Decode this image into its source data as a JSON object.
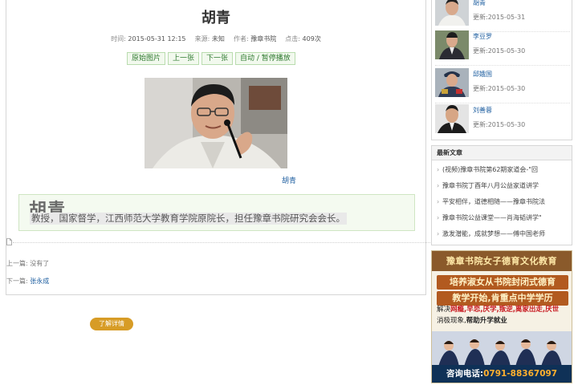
{
  "article": {
    "title": "胡青",
    "meta": {
      "time_label": "时间:",
      "time": "2015-05-31 12:15",
      "source_label": "来源:",
      "source": "未知",
      "author_label": "作者:",
      "author": "豫章书院",
      "views_label": "点击:",
      "views": "409次"
    },
    "buttons": [
      "原始图片",
      "上一张",
      "下一张",
      "自动 / 暂停播放"
    ],
    "photo_caption": "胡青",
    "bio": {
      "name": "胡青",
      "text": "教授，国家督学，江西师范大学教育学院原院长，担任豫章书院研究会会长。"
    },
    "nav": {
      "prev_label": "上一篇:",
      "prev_value": "没有了",
      "next_label": "下一篇:",
      "next_value": "张永成"
    }
  },
  "sidebar": {
    "authors": [
      {
        "name": "胡青",
        "date": "更新:2015-05-31"
      },
      {
        "name": "李豆罗",
        "date": "更新:2015-05-30"
      },
      {
        "name": "邱娥国",
        "date": "更新:2015-05-30"
      },
      {
        "name": "刘善蓉",
        "date": "更新:2015-05-30"
      }
    ],
    "latest": {
      "title": "最新文章",
      "items": [
        "(视频)豫章书院第62期家道会-\"回",
        "豫章书院丁酉年八月公益家道讲学",
        "平安相伴，道德相随——豫章书院法",
        "豫章书院公益课堂——肖海韬讲学\"",
        "激发潜能，成就梦想——傅中国老师"
      ]
    }
  },
  "ad": {
    "title": "豫章书院女子德育文化教育",
    "slogan_1": "培养淑女从书院封闭式德育",
    "slogan_2": "教学开始,肯重点中学学历",
    "desc_prefix": "解决",
    "desc_highlight": "网瘾,早恋,厌学,叛逆,离家出走,厌世",
    "desc_line2": "消极现象,",
    "desc_line2_bold": "帮助升学就业",
    "button": "了解详情",
    "phone_label": "咨询电话:",
    "phone": "0791-88367097"
  },
  "colors": {
    "link": "#1f5fa0",
    "button_text": "#2f7a2f",
    "bio_bg": "#f4faf0",
    "ad_accent": "#c7161d"
  },
  "icons": [
    "document-icon"
  ]
}
